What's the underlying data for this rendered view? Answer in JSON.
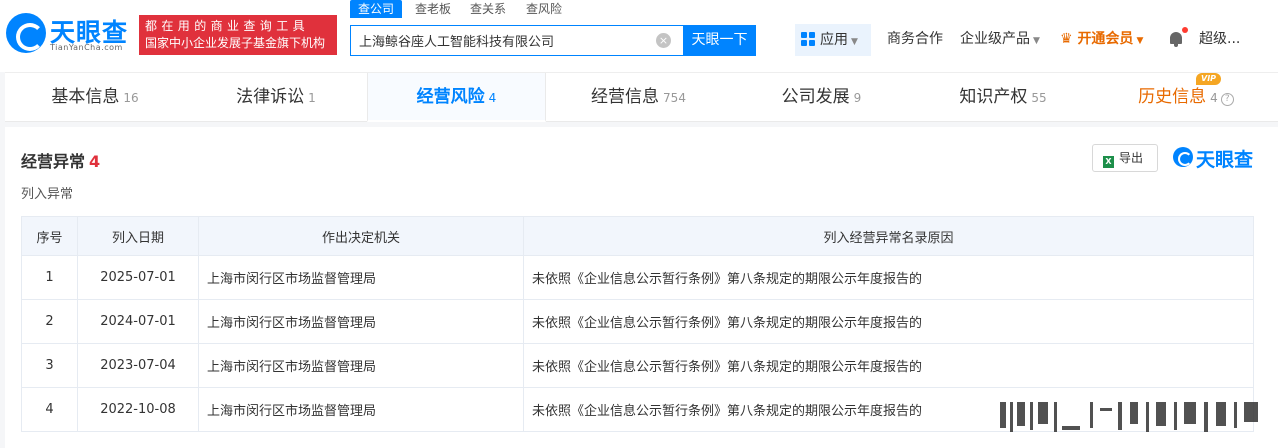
{
  "header": {
    "logo_text": "天眼查",
    "logo_sub": "TianYanCha.com",
    "slogan_line1": "都在用的商业查询工具",
    "slogan_line2": "国家中小企业发展子基金旗下机构",
    "search_tabs": [
      "查公司",
      "查老板",
      "查关系",
      "查风险"
    ],
    "search_value": "上海鲸谷座人工智能科技有限公司",
    "search_button": "天眼一下",
    "nav_app": "应用",
    "nav_business": "商务合作",
    "nav_enterprise": "企业级产品",
    "nav_vip": "开通会员",
    "nav_user": "超级..."
  },
  "tabs": [
    {
      "label": "基本信息",
      "count": "16"
    },
    {
      "label": "法律诉讼",
      "count": "1"
    },
    {
      "label": "经营风险",
      "count": "4"
    },
    {
      "label": "经营信息",
      "count": "754"
    },
    {
      "label": "公司发展",
      "count": "9"
    },
    {
      "label": "知识产权",
      "count": "55"
    },
    {
      "label": "历史信息",
      "count": "4"
    }
  ],
  "vip_badge": "VIP",
  "section": {
    "title": "经营异常",
    "count": "4",
    "subtitle": "列入异常",
    "export_label": "导出",
    "brand": "天眼查"
  },
  "table": {
    "columns": [
      "序号",
      "列入日期",
      "作出决定机关",
      "列入经营异常名录原因"
    ],
    "rows": [
      {
        "no": "1",
        "date": "2025-07-01",
        "authority": "上海市闵行区市场监督管理局",
        "reason": "未依照《企业信息公示暂行条例》第八条规定的期限公示年度报告的"
      },
      {
        "no": "2",
        "date": "2024-07-01",
        "authority": "上海市闵行区市场监督管理局",
        "reason": "未依照《企业信息公示暂行条例》第八条规定的期限公示年度报告的"
      },
      {
        "no": "3",
        "date": "2023-07-04",
        "authority": "上海市闵行区市场监督管理局",
        "reason": "未依照《企业信息公示暂行条例》第八条规定的期限公示年度报告的"
      },
      {
        "no": "4",
        "date": "2022-10-08",
        "authority": "上海市闵行区市场监督管理局",
        "reason": "未依照《企业信息公示暂行条例》第八条规定的期限公示年度报告的"
      }
    ]
  },
  "colors": {
    "brand_blue": "#0084ff",
    "slogan_red": "#e0313c",
    "vip_orange": "#e86a00"
  }
}
